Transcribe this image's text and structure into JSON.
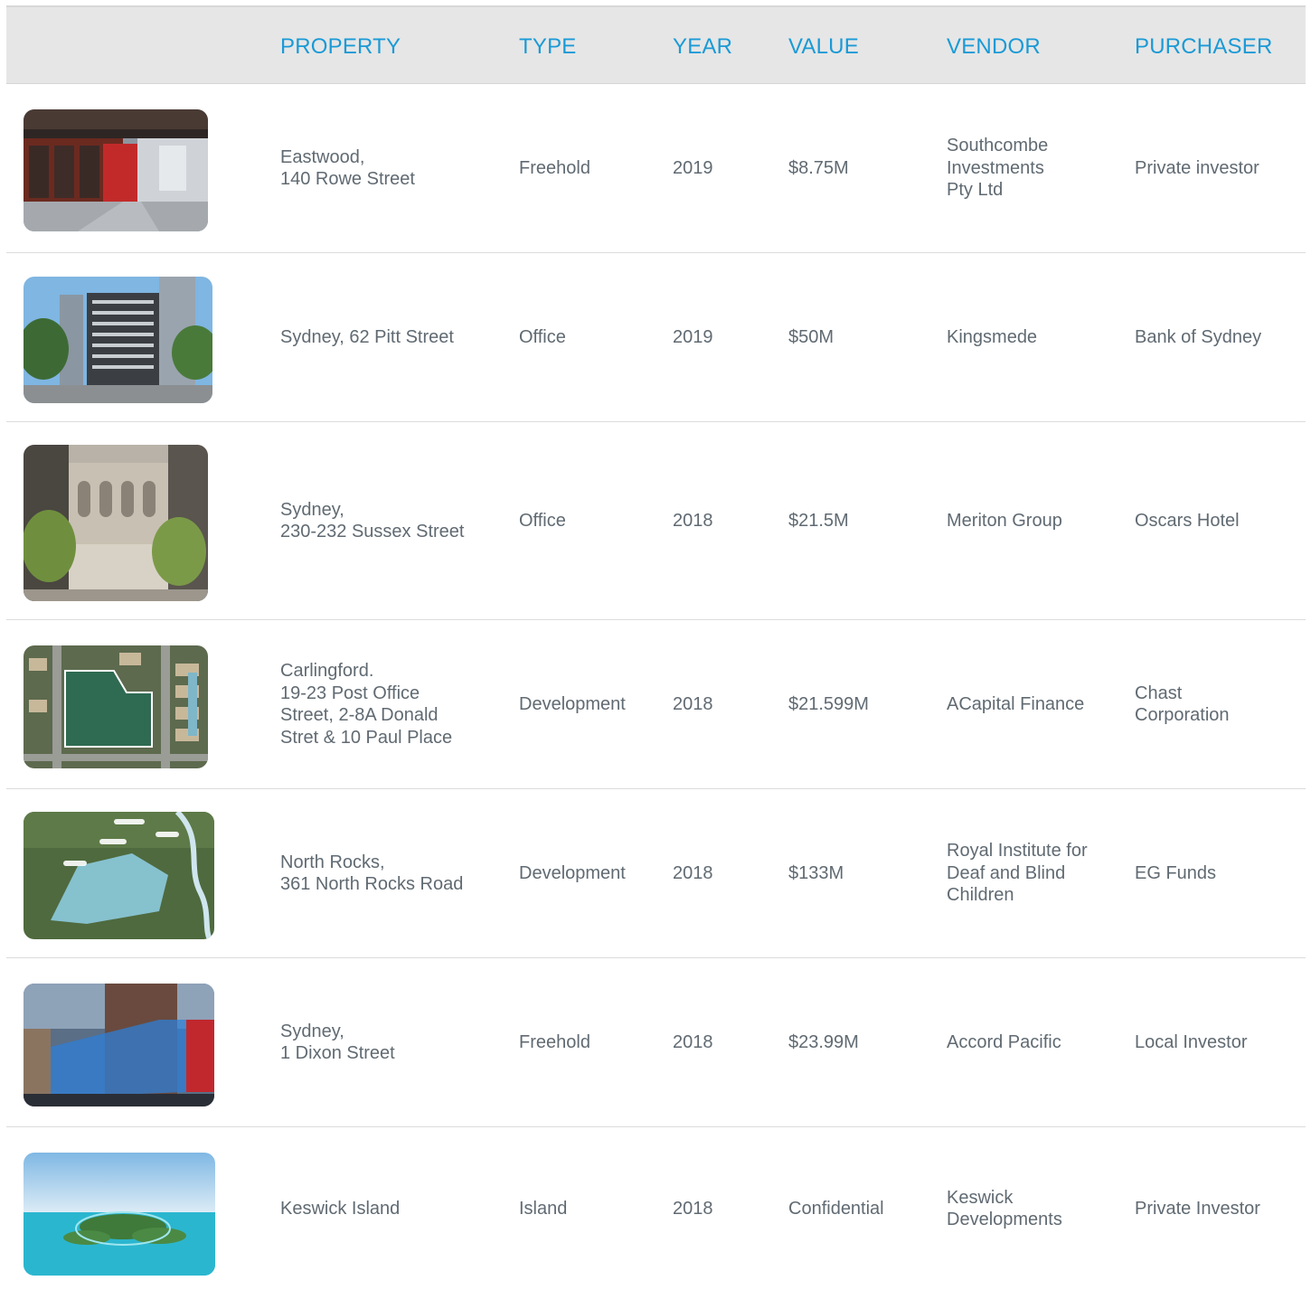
{
  "table": {
    "headers": {
      "property": "PROPERTY",
      "type": "TYPE",
      "year": "YEAR",
      "value": "VALUE",
      "vendor": "VENDOR",
      "purchaser": "PURCHASER"
    },
    "rows": [
      {
        "property": "Eastwood,\n140 Rowe Street",
        "type": "Freehold",
        "year": "2019",
        "value": "$8.75M",
        "vendor": "Southcombe\nInvestments\nPty Ltd",
        "purchaser": "Private investor"
      },
      {
        "property": "Sydney, 62 Pitt Street",
        "type": "Office",
        "year": "2019",
        "value": "$50M",
        "vendor": "Kingsmede",
        "purchaser": "Bank of Sydney"
      },
      {
        "property": "Sydney,\n230-232 Sussex Street",
        "type": "Office",
        "year": "2018",
        "value": "$21.5M",
        "vendor": "Meriton Group",
        "purchaser": "Oscars Hotel"
      },
      {
        "property": "Carlingford.\n19-23 Post Office\nStreet, 2-8A Donald\nStret & 10 Paul Place",
        "type": "Development",
        "year": "2018",
        "value": "$21.599M",
        "vendor": "ACapital Finance",
        "purchaser": "Chast\nCorporation"
      },
      {
        "property": "North Rocks,\n361 North Rocks Road",
        "type": "Development",
        "year": "2018",
        "value": "$133M",
        "vendor": "Royal Institute for\nDeaf and Blind\nChildren",
        "purchaser": "EG Funds"
      },
      {
        "property": "Sydney,\n1 Dixon Street",
        "type": "Freehold",
        "year": "2018",
        "value": "$23.99M",
        "vendor": "Accord Pacific",
        "purchaser": "Local Investor"
      },
      {
        "property": "Keswick Island",
        "type": "Island",
        "year": "2018",
        "value": "Confidential",
        "vendor": "Keswick\nDevelopments",
        "purchaser": "Private Investor"
      }
    ]
  },
  "colors": {
    "header_bg": "#e6e6e6",
    "header_text": "#1a9ad6",
    "body_text": "#606a72",
    "divider": "#dcdcdc"
  }
}
